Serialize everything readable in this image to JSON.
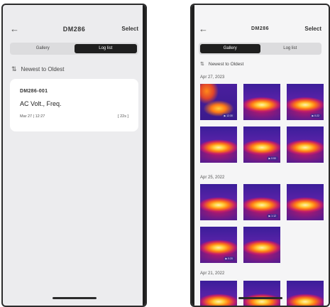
{
  "left": {
    "title": "DM286",
    "select_label": "Select",
    "tabs": [
      "Gallery",
      "Log list"
    ],
    "sort_label": "Newest to Oldest",
    "log": {
      "id": "DM286-001",
      "type": "AC Volt., Freq.",
      "time": "Mar 27 | 12:27",
      "count": "[ 22s ]"
    }
  },
  "right": {
    "title": "DM286",
    "select_label": "Select",
    "tabs": [
      "Gallery",
      "Log list"
    ],
    "sort_label": "Newest to Oldest",
    "groups": [
      {
        "date": "Apr 27, 2023",
        "badges": [
          "▶ 12:30",
          "",
          "▶ 0:22",
          "",
          "▶ 0:50",
          ""
        ]
      },
      {
        "date": "Apr 25, 2022",
        "badges": [
          "",
          "▶ 1:12",
          "",
          "▶ 0:20",
          ""
        ]
      },
      {
        "date": "Apr 21, 2022",
        "badges": [
          "",
          "",
          ""
        ]
      }
    ]
  },
  "colors": {
    "active_tab": "#1f1f1f",
    "card": "#ffffff",
    "left_bg": "#ececee"
  }
}
